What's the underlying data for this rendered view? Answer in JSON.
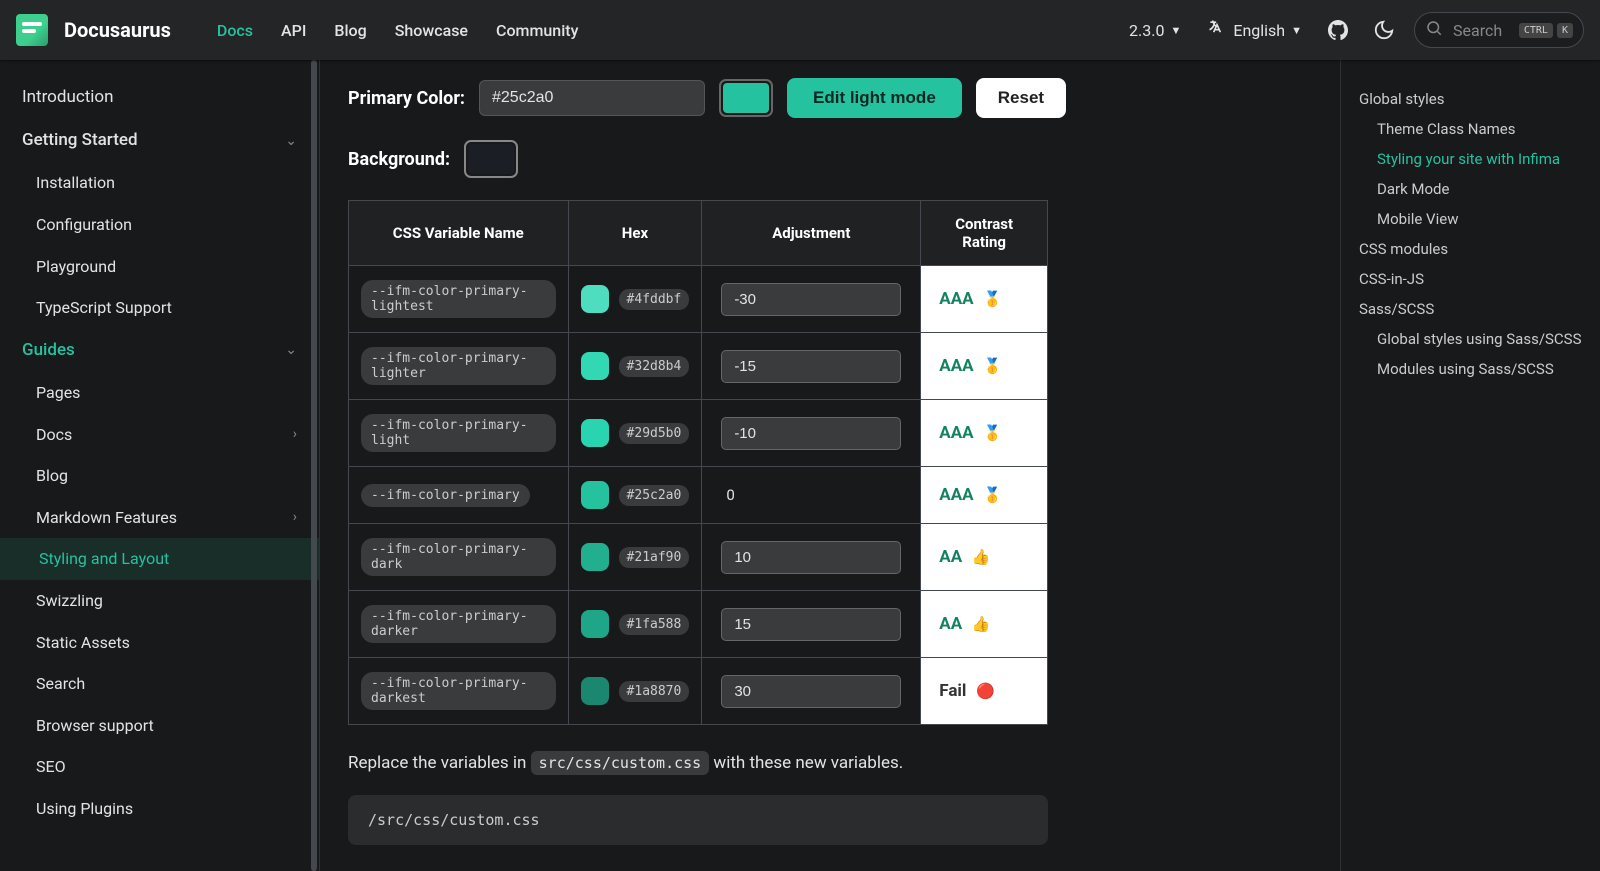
{
  "brand": "Docusaurus",
  "nav": {
    "items": [
      {
        "label": "Docs",
        "active": true
      },
      {
        "label": "API",
        "active": false
      },
      {
        "label": "Blog",
        "active": false
      },
      {
        "label": "Showcase",
        "active": false
      },
      {
        "label": "Community",
        "active": false
      }
    ],
    "version": "2.3.0",
    "language": "English",
    "search_placeholder": "Search",
    "kbd1": "CTRL",
    "kbd2": "K"
  },
  "sidebar": [
    {
      "label": "Introduction",
      "type": "item"
    },
    {
      "label": "Getting Started",
      "type": "cat",
      "expanded": true
    },
    {
      "label": "Installation",
      "type": "sub"
    },
    {
      "label": "Configuration",
      "type": "sub"
    },
    {
      "label": "Playground",
      "type": "sub"
    },
    {
      "label": "TypeScript Support",
      "type": "sub"
    },
    {
      "label": "Guides",
      "type": "cat",
      "expanded": true,
      "active_cat": true
    },
    {
      "label": "Pages",
      "type": "sub"
    },
    {
      "label": "Docs",
      "type": "sub",
      "has_chevron": true
    },
    {
      "label": "Blog",
      "type": "sub"
    },
    {
      "label": "Markdown Features",
      "type": "sub",
      "has_chevron": true
    },
    {
      "label": "Styling and Layout",
      "type": "sub",
      "active": true
    },
    {
      "label": "Swizzling",
      "type": "sub"
    },
    {
      "label": "Static Assets",
      "type": "sub"
    },
    {
      "label": "Search",
      "type": "sub"
    },
    {
      "label": "Browser support",
      "type": "sub"
    },
    {
      "label": "SEO",
      "type": "sub"
    },
    {
      "label": "Using Plugins",
      "type": "sub"
    }
  ],
  "main": {
    "primary_label": "Primary Color:",
    "primary_value": "#25c2a0",
    "primary_swatch": "#25c2a0",
    "edit_btn": "Edit light mode",
    "reset_btn": "Reset",
    "background_label": "Background:",
    "background_swatch": "#1c1e26",
    "table_headers": [
      "CSS Variable Name",
      "Hex",
      "Adjustment",
      "Contrast Rating"
    ],
    "rows": [
      {
        "var": "--ifm-color-primary-lightest",
        "hex": "#4fddbf",
        "swatch": "#4fddbf",
        "adj": "-30",
        "rating": "AAA",
        "emoji": "🥇",
        "rating_class": "aaa",
        "editable": true
      },
      {
        "var": "--ifm-color-primary-lighter",
        "hex": "#32d8b4",
        "swatch": "#32d8b4",
        "adj": "-15",
        "rating": "AAA",
        "emoji": "🥇",
        "rating_class": "aaa",
        "editable": true
      },
      {
        "var": "--ifm-color-primary-light",
        "hex": "#29d5b0",
        "swatch": "#29d5b0",
        "adj": "-10",
        "rating": "AAA",
        "emoji": "🥇",
        "rating_class": "aaa",
        "editable": true
      },
      {
        "var": "--ifm-color-primary",
        "hex": "#25c2a0",
        "swatch": "#25c2a0",
        "adj": "0",
        "rating": "AAA",
        "emoji": "🥇",
        "rating_class": "aaa",
        "editable": false
      },
      {
        "var": "--ifm-color-primary-dark",
        "hex": "#21af90",
        "swatch": "#21af90",
        "adj": "10",
        "rating": "AA",
        "emoji": "👍",
        "rating_class": "aa",
        "editable": true
      },
      {
        "var": "--ifm-color-primary-darker",
        "hex": "#1fa588",
        "swatch": "#1fa588",
        "adj": "15",
        "rating": "AA",
        "emoji": "👍",
        "rating_class": "aa",
        "editable": true
      },
      {
        "var": "--ifm-color-primary-darkest",
        "hex": "#1a8870",
        "swatch": "#1a8870",
        "adj": "30",
        "rating": "Fail",
        "emoji": "🔴",
        "rating_class": "fail",
        "editable": true
      }
    ],
    "replace_pre": "Replace the variables in ",
    "replace_code": "src/css/custom.css",
    "replace_post": " with these new variables.",
    "code_block_title": "/src/css/custom.css"
  },
  "toc": [
    {
      "label": "Global styles",
      "sub": false
    },
    {
      "label": "Theme Class Names",
      "sub": true
    },
    {
      "label": "Styling your site with Infima",
      "sub": true,
      "active": true
    },
    {
      "label": "Dark Mode",
      "sub": true
    },
    {
      "label": "Mobile View",
      "sub": true
    },
    {
      "label": "CSS modules",
      "sub": false
    },
    {
      "label": "CSS-in-JS",
      "sub": false
    },
    {
      "label": "Sass/SCSS",
      "sub": false
    },
    {
      "label": "Global styles using Sass/SCSS",
      "sub": true
    },
    {
      "label": "Modules using Sass/SCSS",
      "sub": true
    }
  ]
}
